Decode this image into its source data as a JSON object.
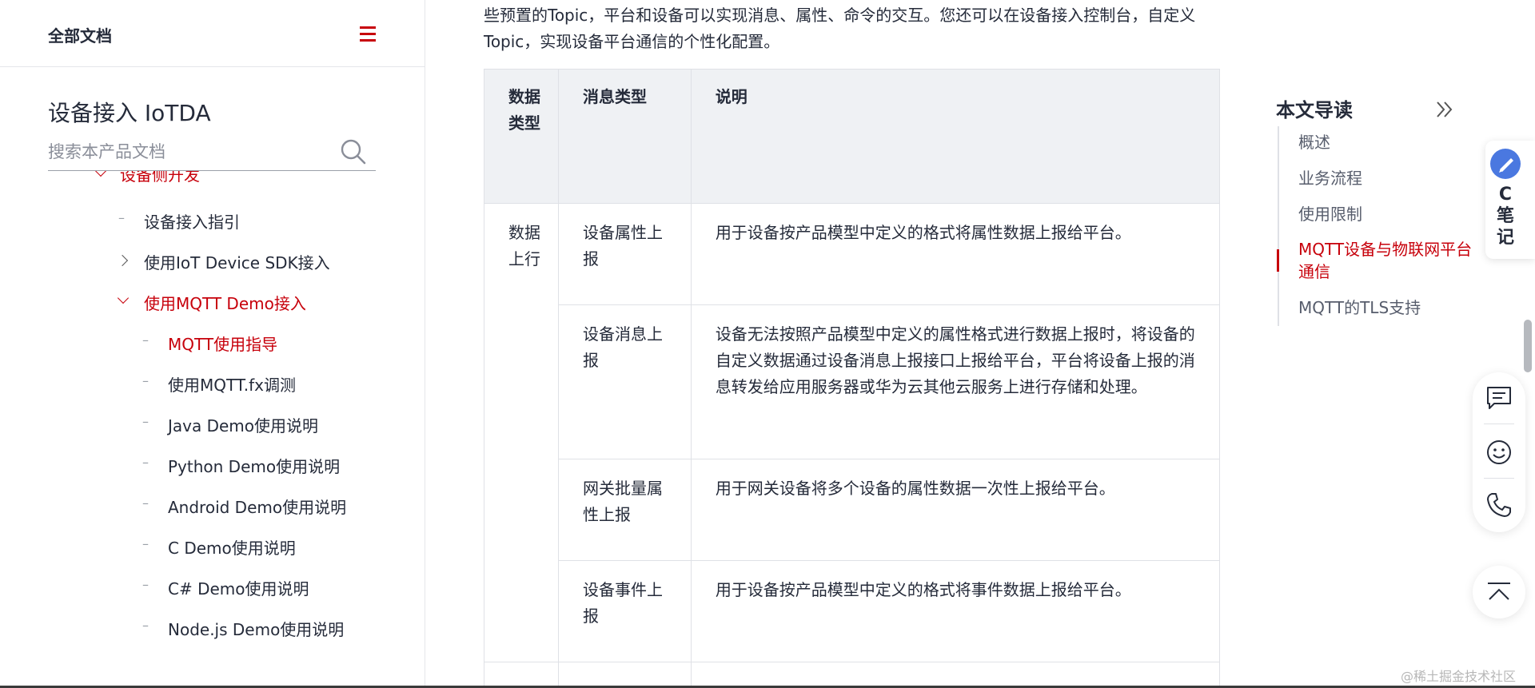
{
  "sidebar": {
    "all_docs": "全部文档",
    "product_title": "设备接入 IoTDA",
    "search_placeholder": "搜索本产品文档",
    "tree": {
      "device_dev": "设备侧开发",
      "access_guide": "设备接入指引",
      "iot_sdk": "使用IoT Device SDK接入",
      "mqtt_demo": "使用MQTT Demo接入",
      "mqtt_guide": "MQTT使用指导",
      "mqttfx": "使用MQTT.fx调测",
      "java_demo": "Java Demo使用说明",
      "python_demo": "Python Demo使用说明",
      "android_demo": "Android Demo使用说明",
      "c_demo": "C Demo使用说明",
      "csharp_demo": "C# Demo使用说明",
      "nodejs_demo": "Node.js Demo使用说明"
    }
  },
  "main": {
    "intro": "些预置的Topic，平台和设备可以实现消息、属性、命令的交互。您还可以在设备接入控制台，自定义Topic，实现设备平台通信的个性化配置。",
    "table": {
      "headers": [
        "数据类型",
        "消息类型",
        "说明"
      ],
      "group": "数据上行",
      "rows": [
        {
          "type": "设备属性上报",
          "desc": "用于设备按产品模型中定义的格式将属性数据上报给平台。"
        },
        {
          "type": "设备消息上报",
          "desc": "设备无法按照产品模型中定义的属性格式进行数据上报时，将设备的自定义数据通过设备消息上报接口上报给平台，平台将设备上报的消息转发给应用服务器或华为云其他云服务上进行存储和处理。"
        },
        {
          "type": "网关批量属性上报",
          "desc": "用于网关设备将多个设备的属性数据一次性上报给平台。"
        },
        {
          "type": "设备事件上报",
          "desc": "用于设备按产品模型中定义的格式将事件数据上报给平台。"
        }
      ]
    }
  },
  "toc": {
    "title": "本文导读",
    "items": [
      "概述",
      "业务流程",
      "使用限制",
      "MQTT设备与物联网平台通信",
      "MQTT的TLS支持"
    ]
  },
  "widgets": {
    "note_text": "C笔记",
    "watermark": "@稀土掘金技术社区"
  },
  "colors": {
    "accent": "#c7000b",
    "header_bg": "#eff1f4",
    "text": "#252b3a"
  },
  "icons": [
    "menu-icon",
    "search-icon",
    "chevron-down-icon",
    "chevron-right-icon",
    "double-chevron-right-icon",
    "feedback-icon",
    "smile-icon",
    "phone-icon",
    "back-to-top-icon",
    "note-icon"
  ]
}
